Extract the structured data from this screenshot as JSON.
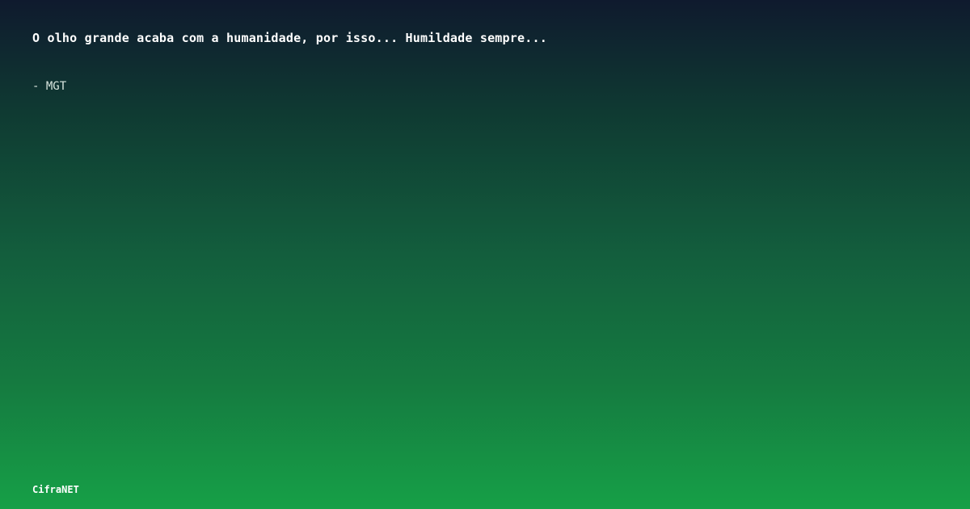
{
  "quote": {
    "text": "O olho grande acaba com a humanidade, por isso... Humildade sempre...",
    "author": "- MGT"
  },
  "brand": {
    "name": "CifraNET"
  },
  "colors": {
    "gradient_top": "#0f1a2e",
    "gradient_bottom": "#16a047",
    "text": "#ffffff"
  }
}
